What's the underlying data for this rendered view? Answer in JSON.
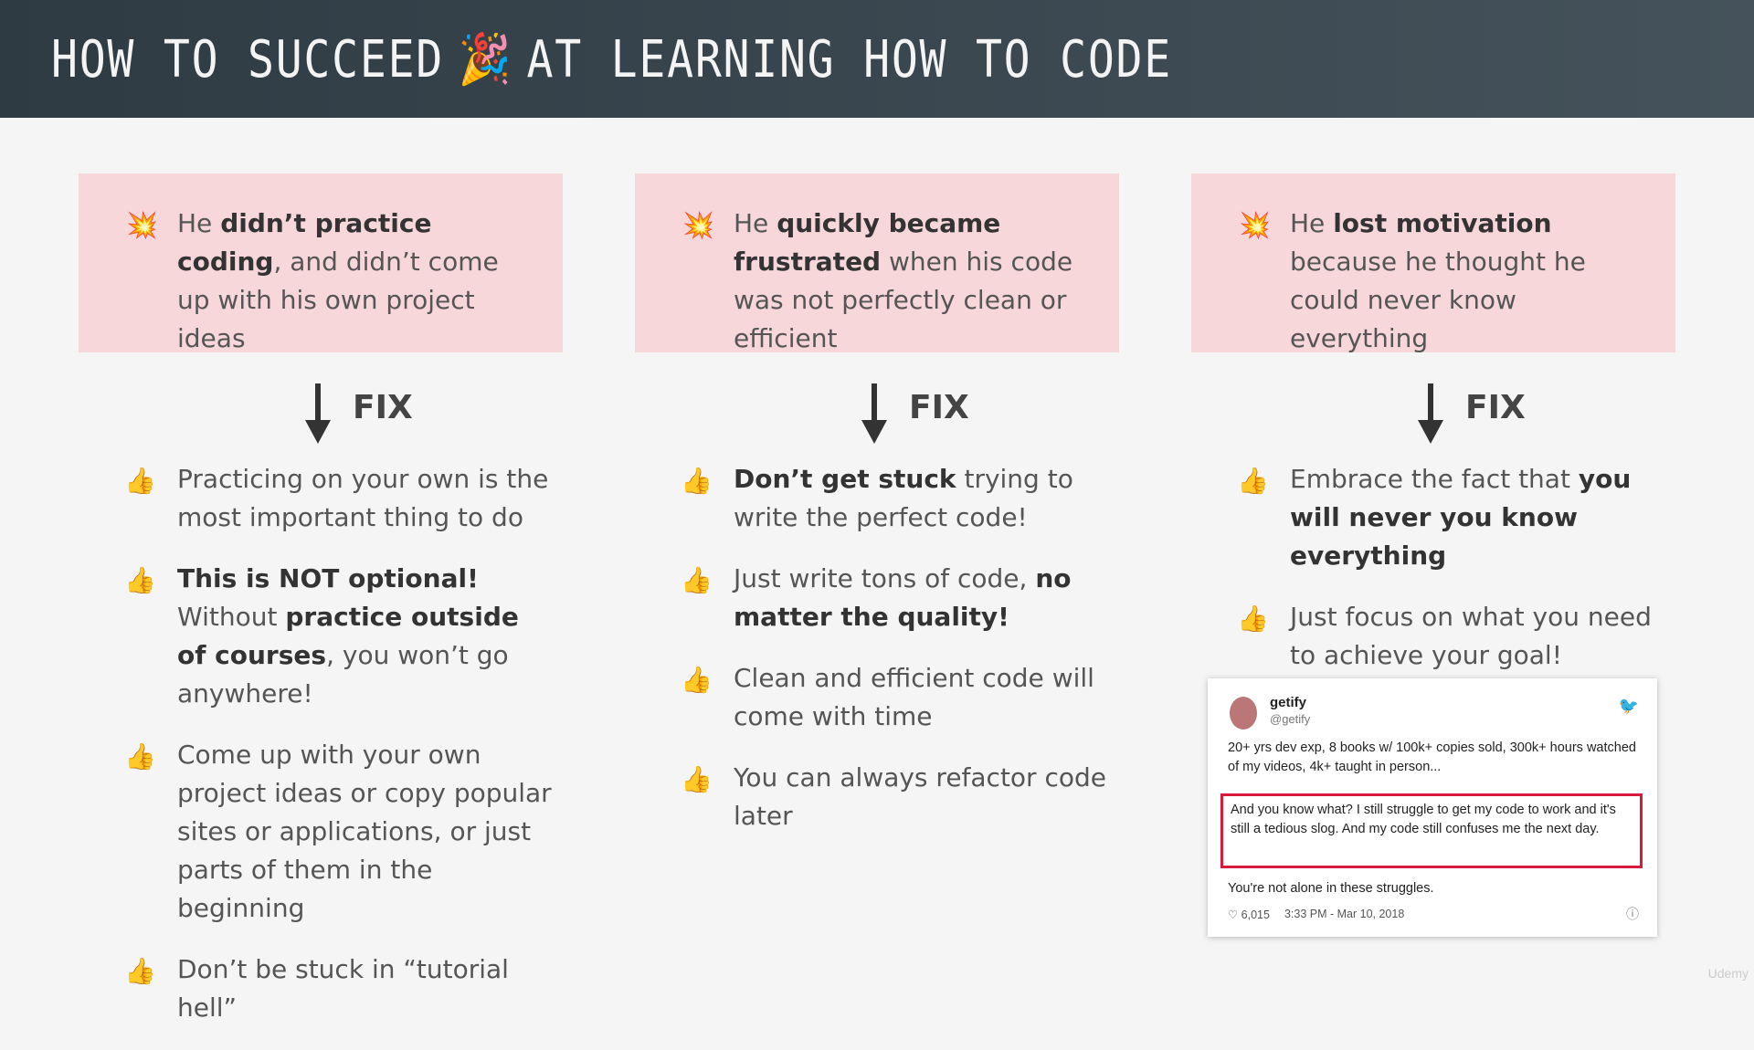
{
  "header": {
    "title_left": "HOW TO SUCCEED",
    "title_right": "AT LEARNING HOW TO CODE",
    "title_emoji": "🎉"
  },
  "columns": [
    {
      "problem": {
        "icon": "💥",
        "pre": "He ",
        "strong": "didn’t practice coding",
        "post": ", and didn’t come up with his own project ideas"
      },
      "fix_label": "FIX",
      "tips": [
        {
          "icon": "👍",
          "parts": [
            {
              "t": "Practicing on your own is the most important thing to do"
            }
          ]
        },
        {
          "icon": "👍",
          "parts": [
            {
              "b": "This is NOT optional!"
            },
            {
              "t": " Without "
            },
            {
              "b": "practice outside of courses"
            },
            {
              "t": ", you won’t go anywhere!"
            }
          ]
        },
        {
          "icon": "👍",
          "parts": [
            {
              "t": "Come up with your own project ideas or copy popular sites or applications, or just parts of them in the beginning"
            }
          ]
        },
        {
          "icon": "👍",
          "parts": [
            {
              "t": "Don’t be stuck in “tutorial hell”"
            }
          ]
        }
      ]
    },
    {
      "problem": {
        "icon": "💥",
        "pre": "He ",
        "strong": "quickly became frustrated",
        "post": " when his code was not perfectly clean or efficient"
      },
      "fix_label": "FIX",
      "tips": [
        {
          "icon": "👍",
          "parts": [
            {
              "b": "Don’t get stuck"
            },
            {
              "t": " trying to write the perfect code!"
            }
          ]
        },
        {
          "icon": "👍",
          "parts": [
            {
              "t": "Just write tons of code, "
            },
            {
              "b": "no matter the quality!"
            }
          ]
        },
        {
          "icon": "👍",
          "parts": [
            {
              "t": "Clean and efficient code will come with time"
            }
          ]
        },
        {
          "icon": "👍",
          "parts": [
            {
              "t": "You can always refactor code later"
            }
          ]
        }
      ]
    },
    {
      "problem": {
        "icon": "💥",
        "pre": "He ",
        "strong": "lost motivation",
        "post": " because he thought he could never know everything"
      },
      "fix_label": "FIX",
      "tips": [
        {
          "icon": "👍",
          "parts": [
            {
              "t": "Embrace the fact that "
            },
            {
              "b": "you will never you know everything"
            }
          ]
        },
        {
          "icon": "👍",
          "parts": [
            {
              "t": "Just focus on what you need to achieve your goal!"
            }
          ]
        }
      ]
    }
  ],
  "tweet": {
    "name": "getify",
    "handle": "@getify",
    "line1": "20+ yrs dev exp, 8 books w/ 100k+ copies sold, 300k+ hours watched of my videos, 4k+ taught in person...",
    "quote": "And you know what? I still struggle to get my code to work and it's still a tedious slog. And my code still confuses me the next day.",
    "line2": "You're not alone in these struggles.",
    "likes": "♡ 6,015",
    "timestamp": "3:33 PM - Mar 10, 2018"
  },
  "watermark": "Udemy"
}
